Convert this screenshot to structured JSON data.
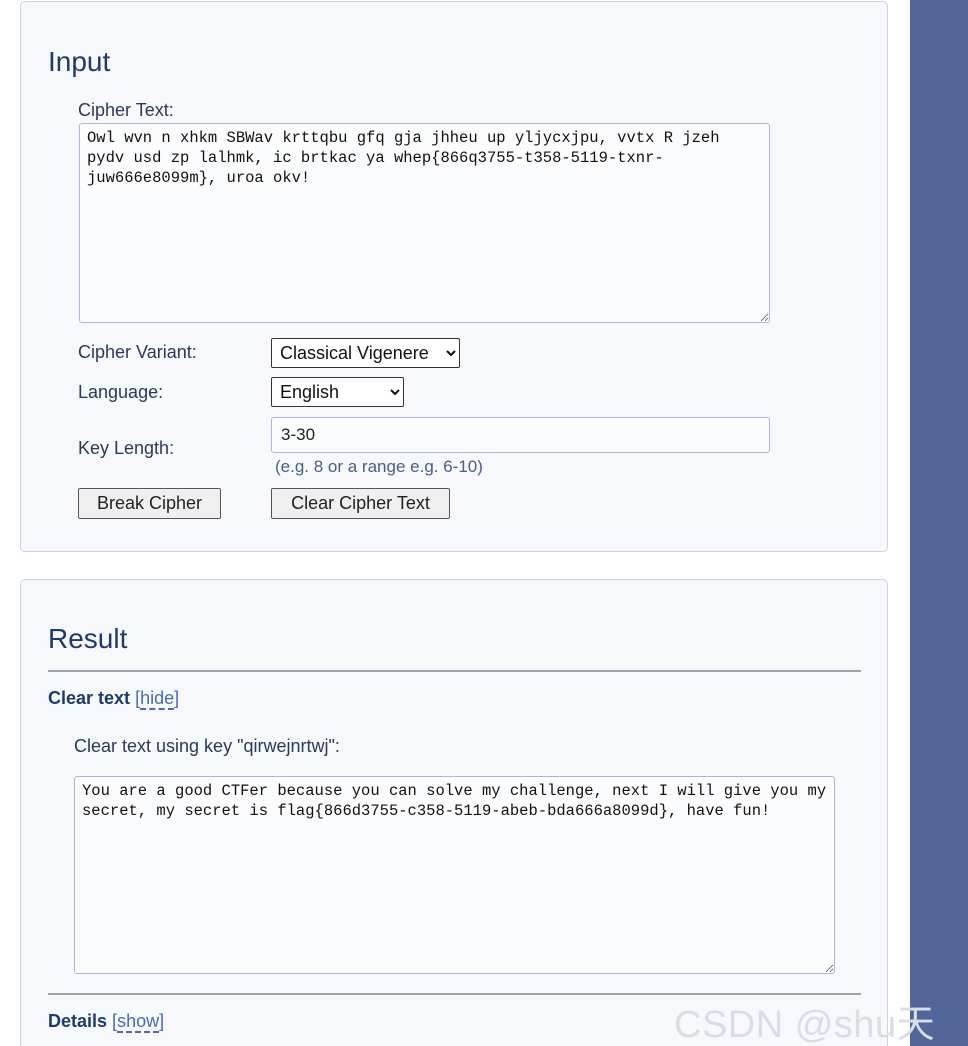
{
  "input_panel": {
    "title": "Input",
    "cipher_text_label": "Cipher Text:",
    "cipher_text_value": "Owl wvn n xhkm SBWav krttqbu gfq gja jhheu up yljycxjpu, vvtx R jzeh pydv usd zp lalhmk, ic brtkac ya whep{866q3755-t358-5119-txnr-juw666e8099m}, uroa okv!",
    "cipher_variant_label": "Cipher Variant:",
    "cipher_variant_selected": "Classical Vigenere",
    "language_label": "Language:",
    "language_selected": "English",
    "key_length_label": "Key Length:",
    "key_length_value": "3-30",
    "key_length_hint": "(e.g. 8 or a range e.g. 6-10)",
    "break_button": "Break Cipher",
    "clear_button": "Clear Cipher Text"
  },
  "result_panel": {
    "title": "Result",
    "clear_text_heading": "Clear text",
    "clear_text_toggle": "hide",
    "clear_text_key_label": "Clear text using key \"qirwejnrtwj\":",
    "clear_text_value": "You are a good CTFer because you can solve my challenge, next I will give you my secret, my secret is flag{866d3755-c358-5119-abeb-bda666a8099d}, have fun!",
    "details_heading": "Details",
    "details_toggle": "show"
  },
  "watermark": "CSDN @shu天",
  "colors": {
    "accent_stripe": "#53669a",
    "title_blue": "#1f3a6e",
    "link_blue": "#4a6ab4",
    "panel_bg": "#f6f8fb"
  }
}
